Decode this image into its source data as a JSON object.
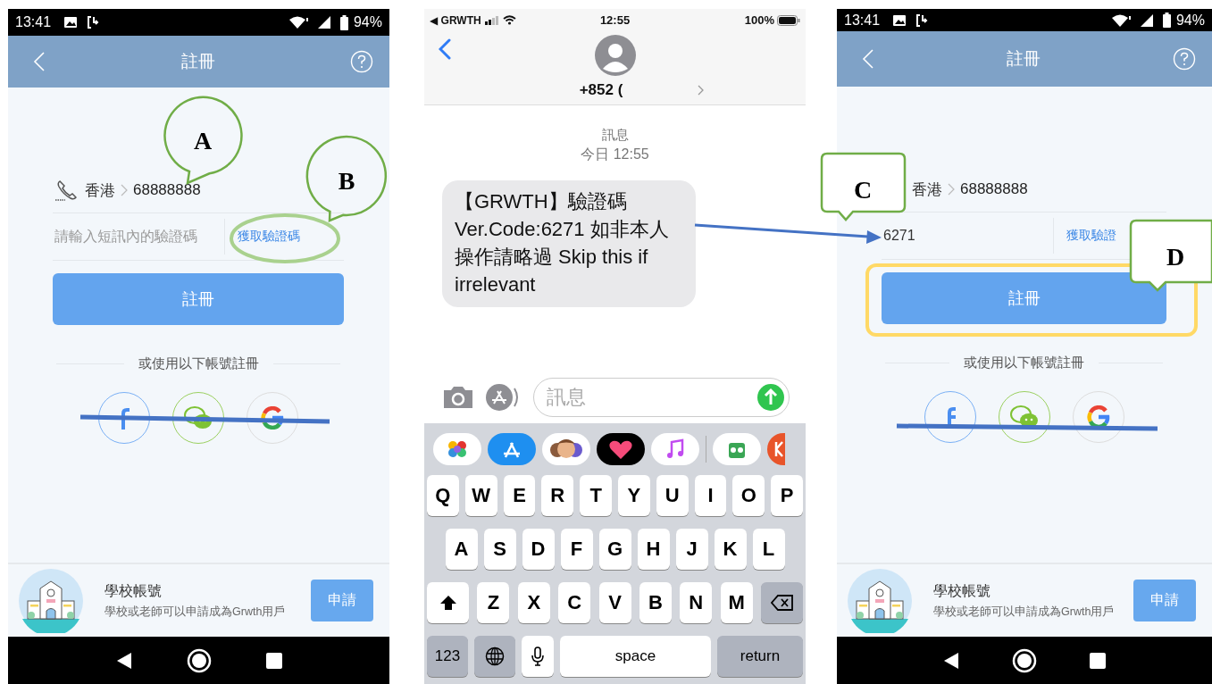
{
  "panels": [
    {
      "kind": "android_register",
      "status_bar": {
        "time": "13:41",
        "battery": "94%"
      },
      "header": {
        "title": "註冊"
      },
      "phone": {
        "icon": true,
        "region": "香港",
        "number": "68888888"
      },
      "code_field": {
        "placeholder": "請輸入短訊內的驗證碼"
      },
      "get_code_link": "獲取驗證碼",
      "register_button": "註冊",
      "alt_login_text": "或使用以下帳號註冊",
      "school": {
        "title": "學校帳號",
        "subtitle": "學校或老師可以申請成為Grwth用戶",
        "apply_button": "申請"
      }
    },
    {
      "kind": "ios_messages",
      "status_bar": {
        "carrier": "◀ GRWTH",
        "time": "12:55",
        "battery": "100%"
      },
      "contact": "+852 (",
      "thread_label": "訊息",
      "timestamp": "今日 12:55",
      "message": "【GRWTH】驗證碼 Ver.Code:6271 如非本人操作請略過 Skip this if irrelevant",
      "input": {
        "placeholder": "訊息"
      },
      "keyboard": {
        "rows": [
          {
            "keys": [
              {
                "kind": "letter",
                "label": "Q"
              },
              {
                "kind": "letter",
                "label": "W"
              },
              {
                "kind": "letter",
                "label": "E"
              },
              {
                "kind": "letter",
                "label": "R"
              },
              {
                "kind": "letter",
                "label": "T"
              },
              {
                "kind": "letter",
                "label": "Y"
              },
              {
                "kind": "letter",
                "label": "U"
              },
              {
                "kind": "letter",
                "label": "I"
              },
              {
                "kind": "letter",
                "label": "O"
              },
              {
                "kind": "letter",
                "label": "P"
              }
            ]
          },
          {
            "keys": [
              {
                "kind": "letter",
                "label": "A"
              },
              {
                "kind": "letter",
                "label": "S"
              },
              {
                "kind": "letter",
                "label": "D"
              },
              {
                "kind": "letter",
                "label": "F"
              },
              {
                "kind": "letter",
                "label": "G"
              },
              {
                "kind": "letter",
                "label": "H"
              },
              {
                "kind": "letter",
                "label": "J"
              },
              {
                "kind": "letter",
                "label": "K"
              },
              {
                "kind": "letter",
                "label": "L"
              }
            ]
          },
          {
            "keys": [
              {
                "kind": "shift"
              },
              {
                "kind": "letter",
                "label": "Z"
              },
              {
                "kind": "letter",
                "label": "X"
              },
              {
                "kind": "letter",
                "label": "C"
              },
              {
                "kind": "letter",
                "label": "V"
              },
              {
                "kind": "letter",
                "label": "B"
              },
              {
                "kind": "letter",
                "label": "N"
              },
              {
                "kind": "letter",
                "label": "M"
              },
              {
                "kind": "delete"
              }
            ]
          },
          {
            "keys": [
              {
                "kind": "function",
                "label": "123"
              },
              {
                "kind": "globe"
              },
              {
                "kind": "mic"
              },
              {
                "kind": "space",
                "label": "space"
              },
              {
                "kind": "return",
                "label": "return"
              }
            ]
          }
        ]
      }
    },
    {
      "kind": "android_register",
      "status_bar": {
        "time": "13:41",
        "battery": "94%"
      },
      "header": {
        "title": "註冊"
      },
      "phone": {
        "icon": false,
        "region": "香港",
        "number": "68888888"
      },
      "code_field": {
        "value": "6271"
      },
      "get_code_link": "獲取驗證",
      "register_button": "註冊",
      "alt_login_text": "或使用以下帳號註冊",
      "school": {
        "title": "學校帳號",
        "subtitle": "學校或老師可以申請成為Grwth用戶",
        "apply_button": "申請"
      }
    }
  ],
  "annotations": [
    {
      "kind": "round",
      "label": "A"
    },
    {
      "kind": "round",
      "label": "B"
    },
    {
      "kind": "box",
      "label": "C"
    },
    {
      "kind": "box",
      "label": "D"
    }
  ]
}
